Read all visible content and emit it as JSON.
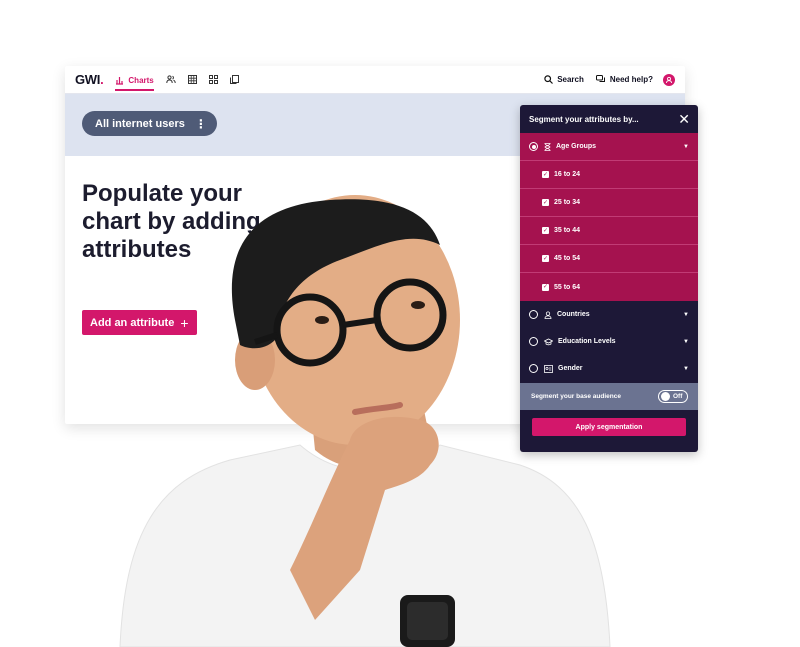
{
  "app": {
    "logo_text": "GWI",
    "logo_dot": ".",
    "nav": {
      "charts_label": "Charts"
    },
    "search_label": "Search",
    "help_label": "Need help?"
  },
  "audience": {
    "name": "All internet users",
    "menu_glyph": "⋮"
  },
  "main": {
    "headline": "Populate your chart by adding attributes",
    "add_attribute_label": "Add an attribute",
    "add_attribute_glyph": "+"
  },
  "panel": {
    "title": "Segment your attributes by...",
    "close_glyph": "✕",
    "groups": [
      {
        "label": "Age Groups",
        "selected": true,
        "icon": "hourglass-icon",
        "options": [
          "16 to 24",
          "25 to 34",
          "35 to 44",
          "45 to 54",
          "55 to 64"
        ]
      },
      {
        "label": "Countries",
        "selected": false,
        "icon": "person-icon"
      },
      {
        "label": "Education Levels",
        "selected": false,
        "icon": "graduation-cap-icon"
      },
      {
        "label": "Gender",
        "selected": false,
        "icon": "id-card-icon"
      }
    ],
    "caret_glyph": "▼",
    "base_audience_label": "Segment your base audience",
    "toggle_label": "Off",
    "apply_label": "Apply segmentation"
  },
  "colors": {
    "brand": "#d3176b",
    "panel_bg": "#1d1837",
    "active_group": "#a5124f",
    "audience_pill": "#4f5b77",
    "audience_band": "#dde3f0"
  }
}
